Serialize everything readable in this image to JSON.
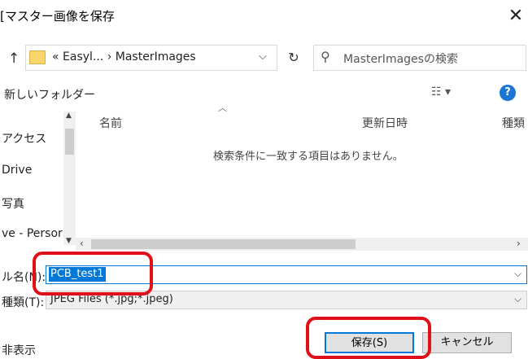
{
  "window": {
    "title": "[マスター画像を保存",
    "close_glyph": "✕"
  },
  "address": {
    "breadcrumb": "« Easyl...  ›  MasterImages",
    "dropdown_glyph": "⌵",
    "refresh_glyph": "↻",
    "up_glyph": "↑"
  },
  "search": {
    "placeholder": "MasterImagesの検索",
    "icon_glyph": "⚲"
  },
  "toolbar": {
    "new_folder": "新しいフォルダー",
    "view_glyph": "☷ ▾",
    "help_glyph": "?"
  },
  "nav": {
    "items": [
      {
        "label": "アクセス"
      },
      {
        "label": "Drive"
      },
      {
        "label": "写真"
      },
      {
        "label": "ve - Persor"
      }
    ]
  },
  "columns": [
    {
      "label": "名前"
    },
    {
      "label": "更新日時"
    },
    {
      "label": "種類"
    }
  ],
  "empty_message": "検索条件に一致する項目はありません。",
  "filename": {
    "label": "ル名(N):",
    "value": "PCB_test1"
  },
  "filetype": {
    "label": "種類(T):",
    "value": "JPEG Files (*.jpg;*.jpeg)"
  },
  "footer": {
    "hide_folders": "非表示",
    "save_label": "保存(S)",
    "cancel_label": "キャンセル"
  },
  "colors": {
    "accent": "#0078d7",
    "annotation_red": "#e0101a",
    "help_blue": "#1976d2"
  }
}
